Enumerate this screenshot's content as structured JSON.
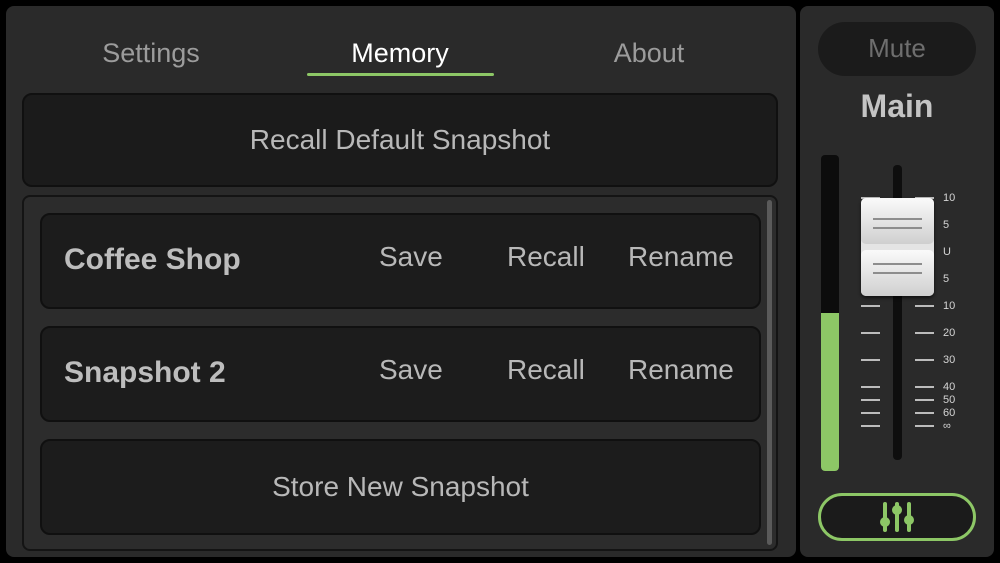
{
  "tabs": [
    {
      "label": "Settings",
      "active": false
    },
    {
      "label": "Memory",
      "active": true
    },
    {
      "label": "About",
      "active": false
    }
  ],
  "recall_default_label": "Recall Default Snapshot",
  "snapshots": [
    {
      "name": "Coffee Shop",
      "save_label": "Save",
      "recall_label": "Recall",
      "rename_label": "Rename"
    },
    {
      "name": "Snapshot 2",
      "save_label": "Save",
      "recall_label": "Recall",
      "rename_label": "Rename"
    }
  ],
  "store_new_label": "Store New Snapshot",
  "channel": {
    "mute_label": "Mute",
    "name": "Main",
    "meter_level": 0.5,
    "scale_labels": [
      "10",
      "5",
      "U",
      "5",
      "10",
      "20",
      "30",
      "40",
      "50",
      "60",
      "∞"
    ],
    "mixer_icon": "sliders-icon"
  },
  "colors": {
    "accent": "#8dc766",
    "panel": "#2a2a2a",
    "button_bg": "#1b1b1b"
  }
}
